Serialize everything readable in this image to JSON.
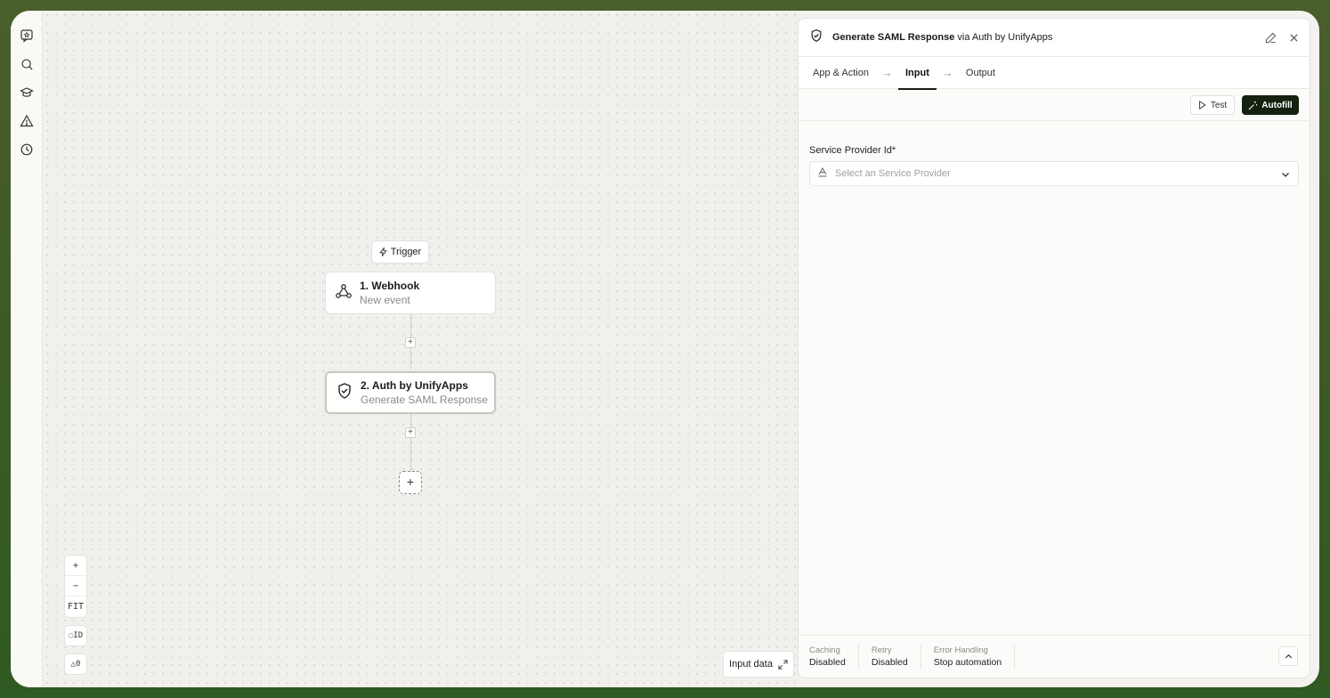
{
  "sidebar": {
    "items": [
      {
        "icon": "chat-star-icon"
      },
      {
        "icon": "search-icon"
      },
      {
        "icon": "graduation-cap-icon"
      },
      {
        "icon": "warning-icon"
      },
      {
        "icon": "history-icon"
      }
    ]
  },
  "canvas": {
    "trigger_label": "Trigger",
    "nodes": [
      {
        "title": "1. Webhook",
        "subtitle": "New event",
        "icon": "webhook-icon"
      },
      {
        "title": "2. Auth by UnifyApps",
        "subtitle": "Generate SAML Response",
        "icon": "shield-check-icon"
      }
    ],
    "add_step_symbol": "+",
    "zoom": {
      "in": "+",
      "out": "−",
      "fit": "FIT"
    },
    "id_toggle": "ID",
    "warnings_label": "0",
    "input_data_label": "Input data"
  },
  "panel": {
    "title": "Generate SAML Response",
    "title_via": "via Auth by UnifyApps",
    "tabs": [
      {
        "label": "App & Action"
      },
      {
        "label": "Input"
      },
      {
        "label": "Output"
      }
    ],
    "test_label": "Test",
    "autofill_label": "Autofill",
    "field": {
      "label": "Service Provider Id*",
      "placeholder": "Select an Service Provider"
    },
    "footer": [
      {
        "label": "Caching",
        "value": "Disabled"
      },
      {
        "label": "Retry",
        "value": "Disabled"
      },
      {
        "label": "Error Handling",
        "value": "Stop automation"
      }
    ]
  },
  "colors": {
    "accent_dark": "#15210f",
    "frame_bg": "#3c5a25"
  }
}
